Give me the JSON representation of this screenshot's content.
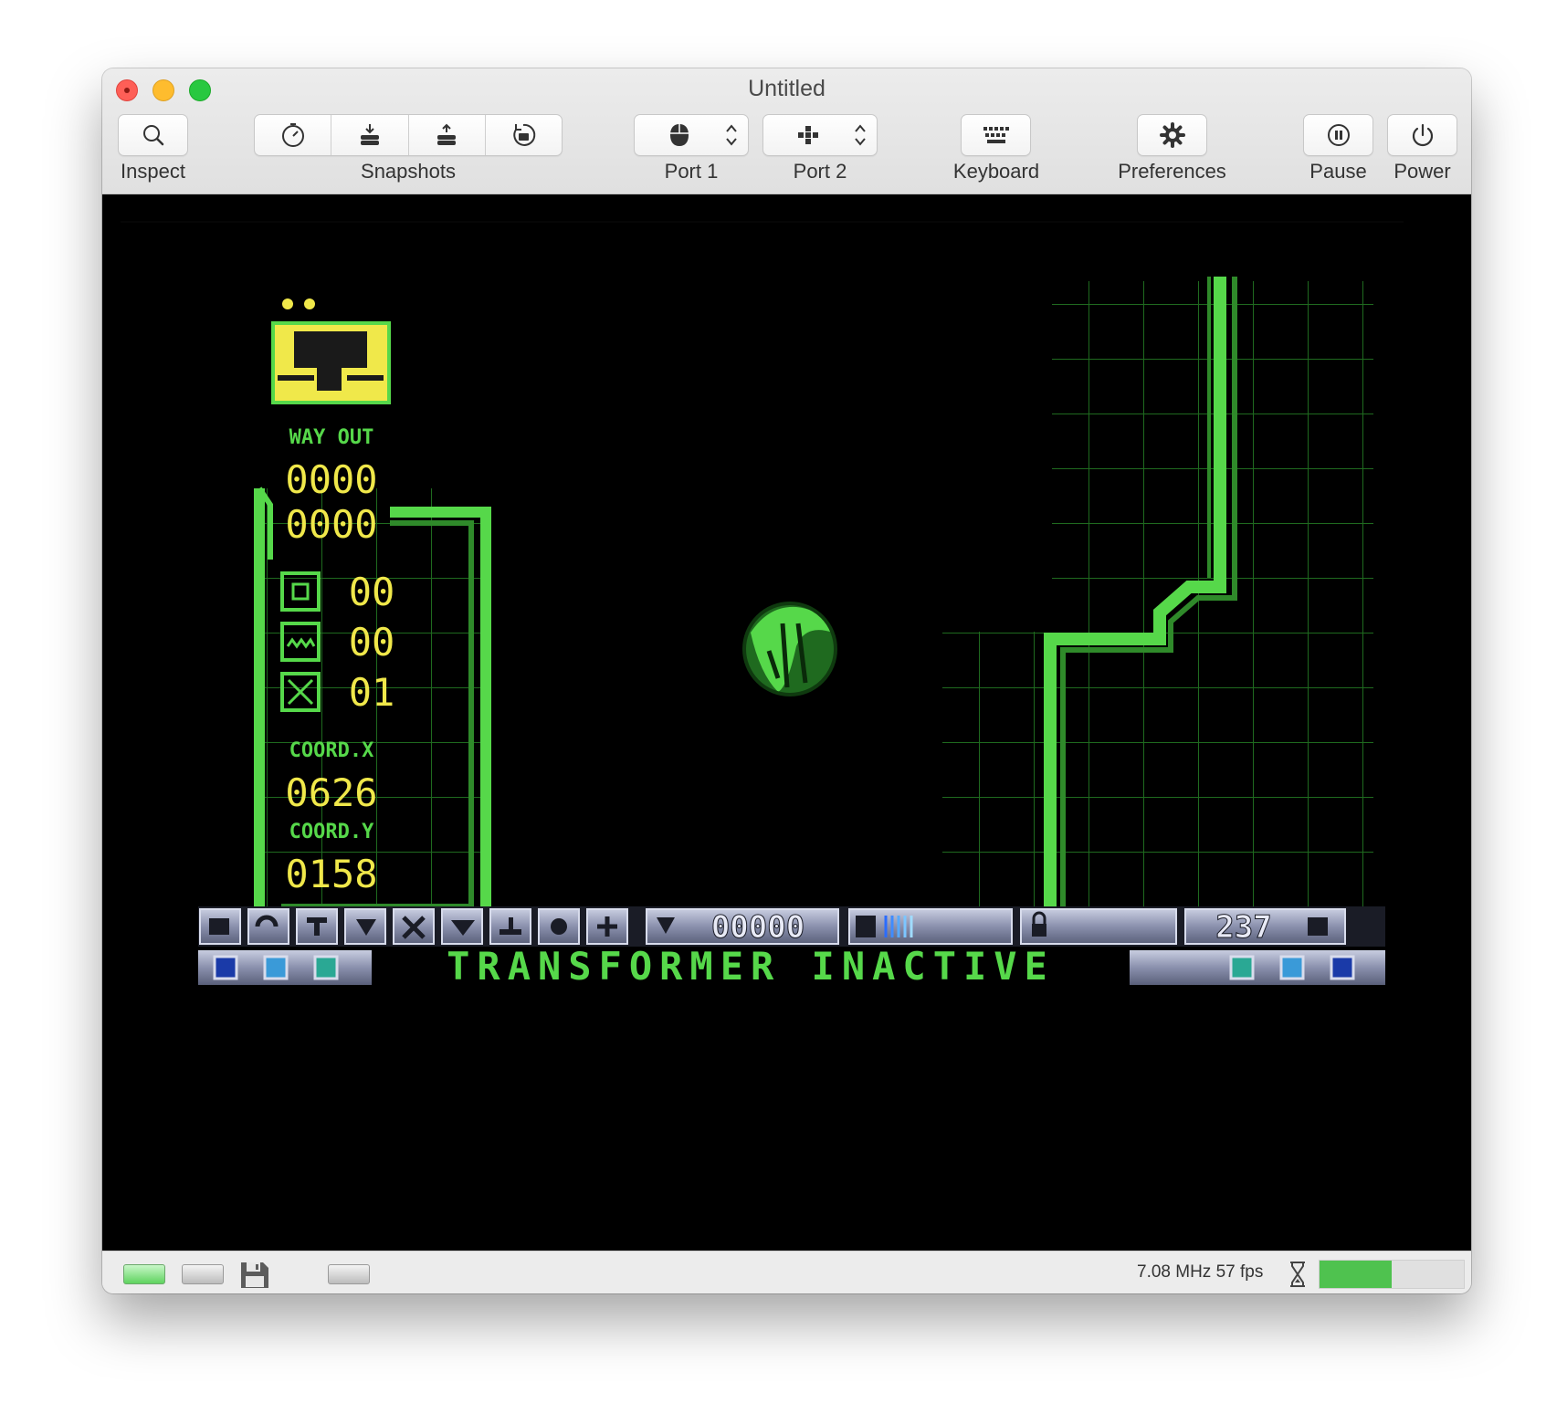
{
  "window": {
    "title": "Untitled"
  },
  "toolbar": {
    "inspect": "Inspect",
    "snapshots": "Snapshots",
    "port1": "Port 1",
    "port2": "Port 2",
    "keyboard": "Keyboard",
    "preferences": "Preferences",
    "pause": "Pause",
    "power": "Power"
  },
  "game": {
    "lives_icon": "two-dots-icon",
    "way_out_label": "WAY OUT",
    "way_out_1": "0000",
    "way_out_2": "0000",
    "item1_count": "00",
    "item2_count": "00",
    "item3_count": "01",
    "coord_x_label": "COORD.X",
    "coord_x": "0626",
    "coord_y_label": "COORD.Y",
    "coord_y": "0158",
    "score": "00000",
    "energy": "237",
    "status_message": "TRANSFORMER INACTIVE",
    "colors": {
      "green": "#56d84a",
      "yellow": "#f0e84a",
      "dark_green": "#1e5c1e",
      "panel": "#8c94b4"
    }
  },
  "status": {
    "speed": "7.08 MHz 57 fps",
    "cpu_load": 0.5
  }
}
